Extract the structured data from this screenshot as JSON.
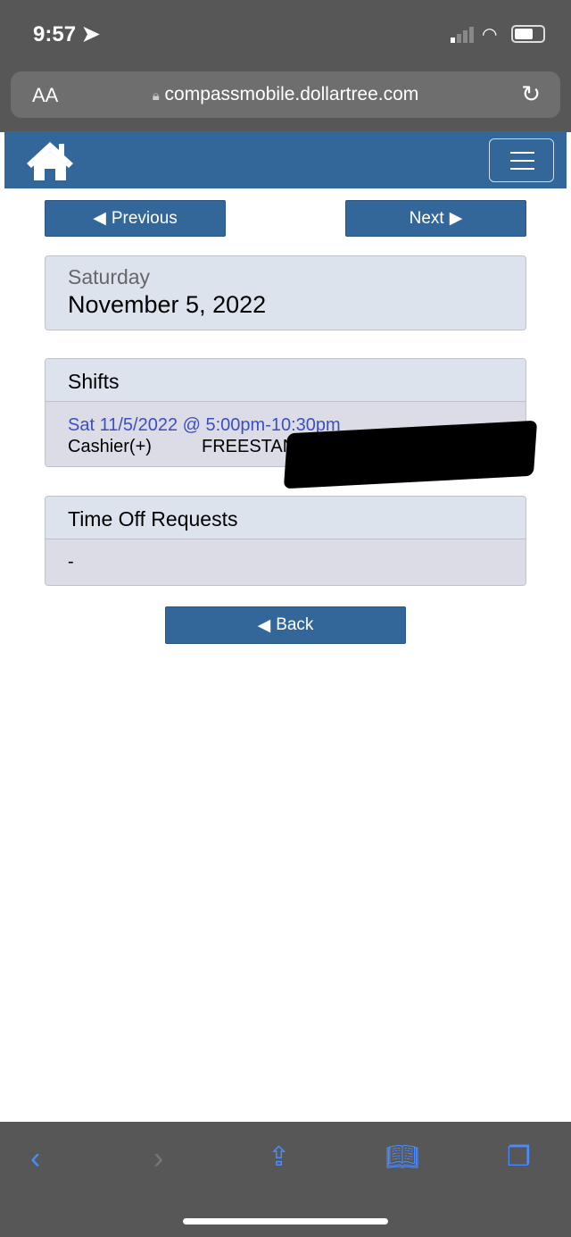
{
  "status_bar": {
    "time": "9:57"
  },
  "browser": {
    "text_size_label": "AA",
    "url": "compassmobile.dollartree.com"
  },
  "nav": {
    "previous": "Previous",
    "next": "Next",
    "back": "Back"
  },
  "date_panel": {
    "weekday": "Saturday",
    "date": "November 5, 2022"
  },
  "shifts": {
    "title": "Shifts",
    "items": [
      {
        "time": "Sat 11/5/2022 @ 5:00pm-10:30pm",
        "role": "Cashier(+)",
        "location": "FREESTANDER"
      }
    ]
  },
  "time_off": {
    "title": "Time Off Requests",
    "value": "-"
  },
  "colors": {
    "brand": "#336699",
    "link": "#3b4fc4"
  }
}
